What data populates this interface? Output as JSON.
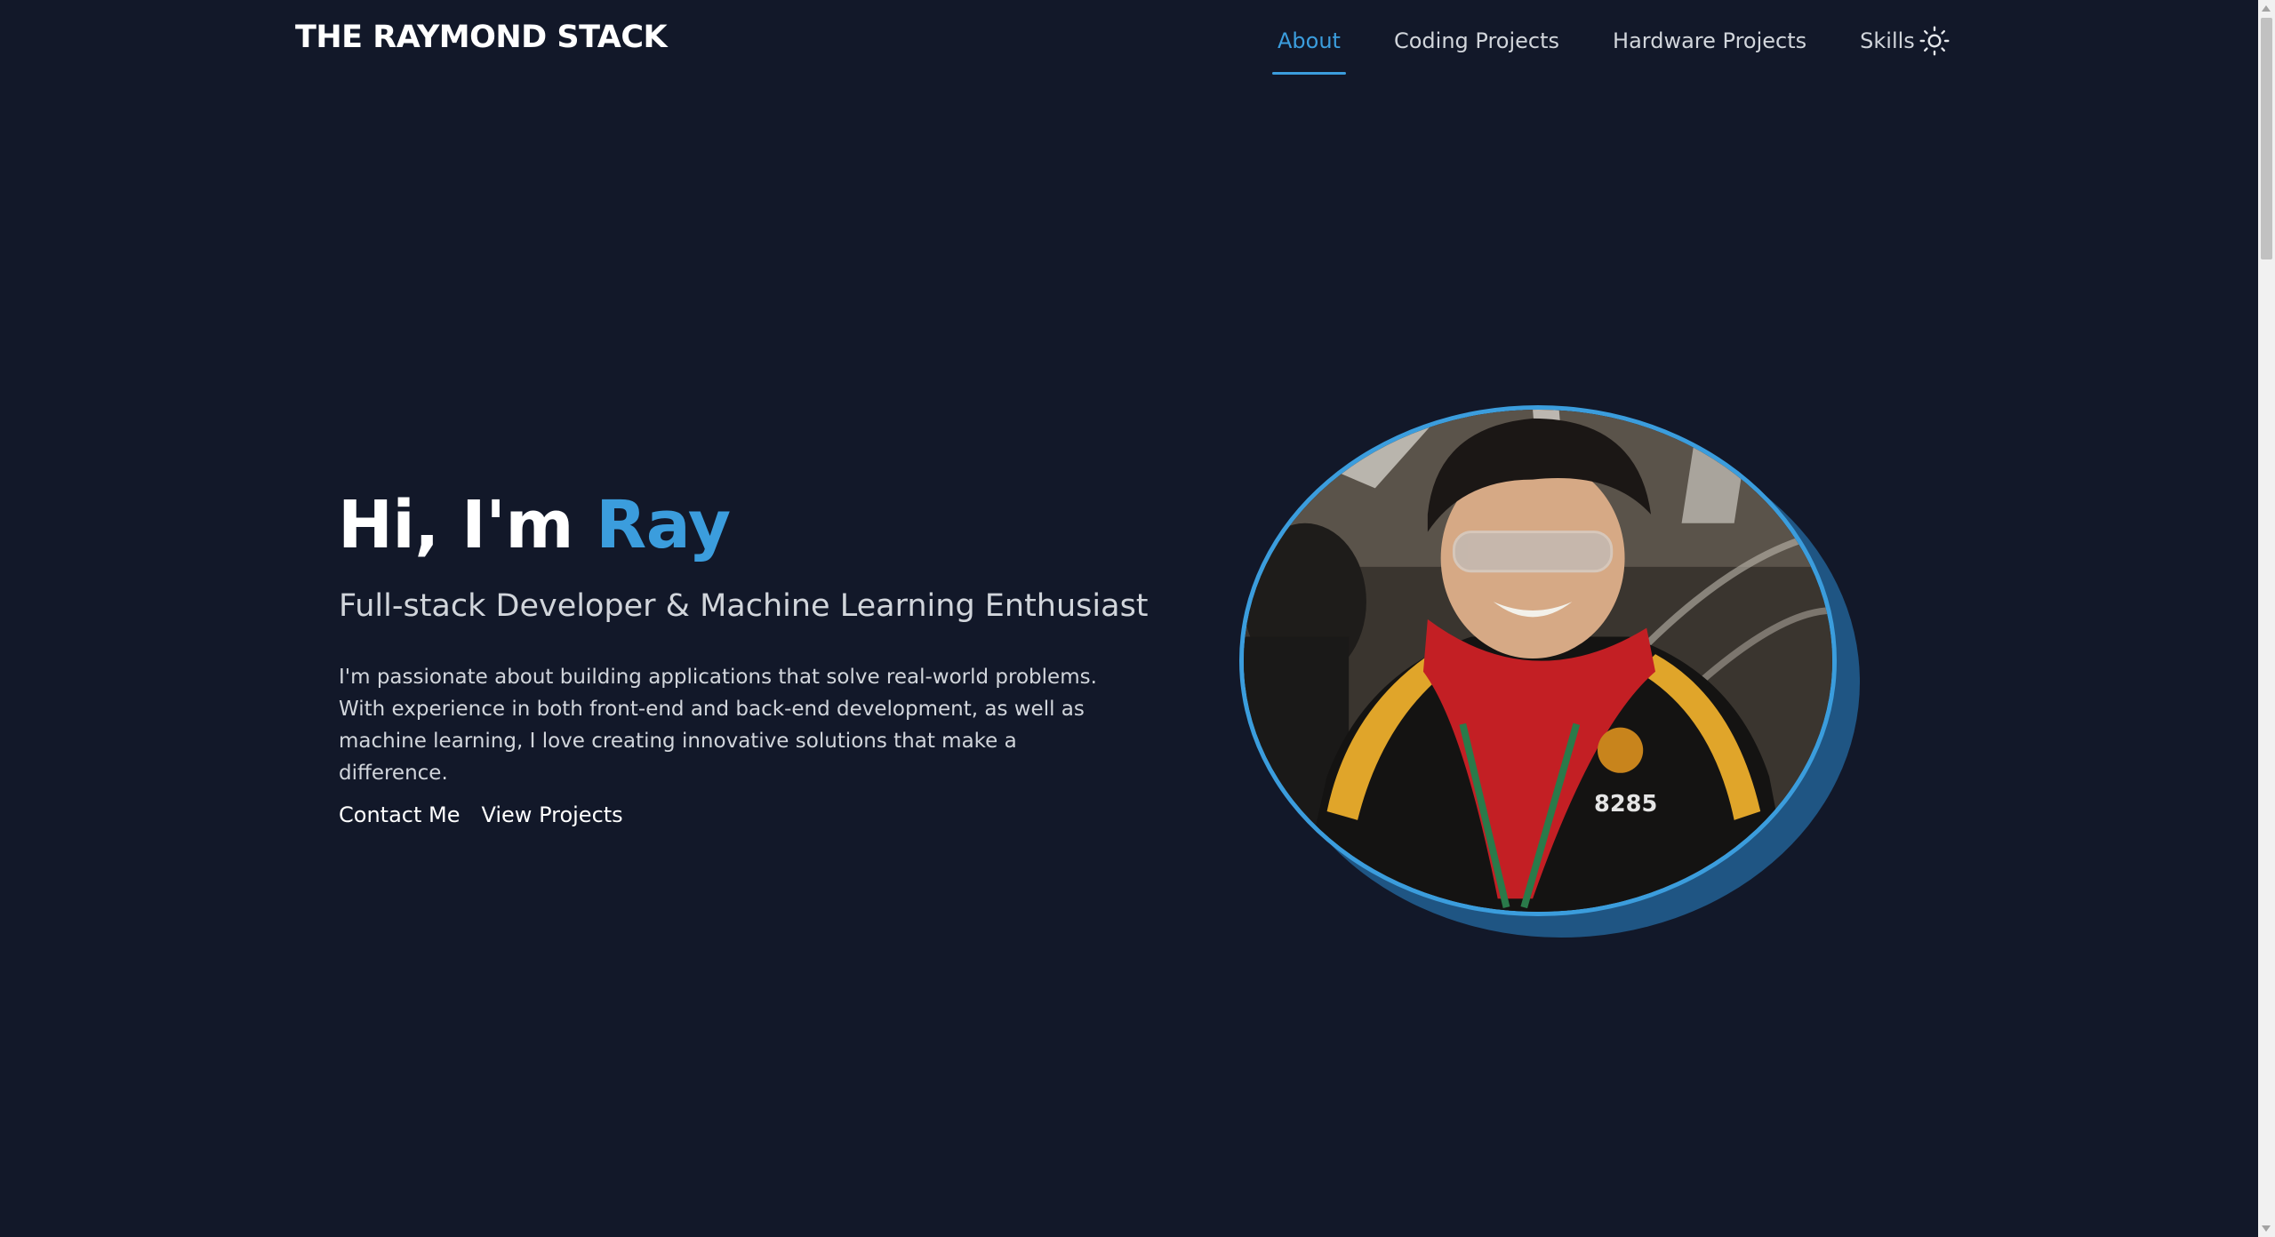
{
  "header": {
    "brand": "THE RAYMOND STACK",
    "nav": [
      {
        "label": "About",
        "active": true
      },
      {
        "label": "Coding Projects",
        "active": false
      },
      {
        "label": "Hardware Projects",
        "active": false
      },
      {
        "label": "Skills",
        "active": false
      }
    ],
    "theme_toggle_icon": "sun-icon"
  },
  "hero": {
    "greeting": "Hi, I'm",
    "name": "Ray",
    "subtitle": "Full-stack Developer & Machine Learning Enthusiast",
    "description": "I'm passionate about building applications that solve real-world problems. With experience in both front-end and back-end development, as well as machine learning, I love creating innovative solutions that make a difference.",
    "actions": {
      "contact": "Contact Me",
      "projects": "View Projects"
    },
    "portrait_badge": "8285"
  },
  "colors": {
    "background": "#121829",
    "accent": "#3b9ddd",
    "portrait_shadow": "#1f5583",
    "text": "#ffffff"
  }
}
